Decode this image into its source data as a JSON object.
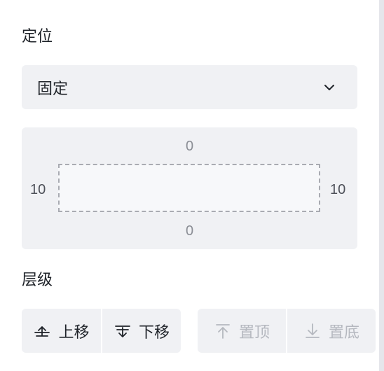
{
  "position": {
    "section_label": "定位",
    "mode_value": "固定",
    "dropdown_icon": "chevron-down-icon"
  },
  "box_offsets": {
    "top": "0",
    "bottom": "0",
    "left": "10",
    "right": "10"
  },
  "layer": {
    "section_label": "层级",
    "move_up_label": "上移",
    "move_down_label": "下移",
    "to_top_label": "置顶",
    "to_bottom_label": "置底"
  },
  "colors": {
    "control_bg": "#f0f1f4",
    "text_primary": "#1f2329",
    "text_disabled": "#b5b8bf"
  }
}
